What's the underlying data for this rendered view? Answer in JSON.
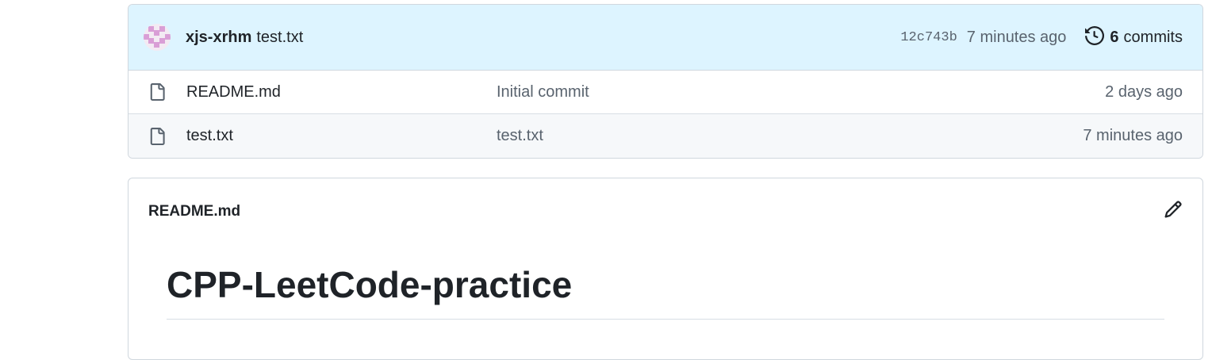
{
  "latest_commit": {
    "author": "xjs-xrhm",
    "message": "test.txt",
    "sha": "12c743b",
    "time": "7 minutes ago",
    "commit_count": "6",
    "commit_count_label": "commits"
  },
  "files": [
    {
      "name": "README.md",
      "commit_message": "Initial commit",
      "age": "2 days ago",
      "icon": "file-icon"
    },
    {
      "name": "test.txt",
      "commit_message": "test.txt",
      "age": "7 minutes ago",
      "icon": "file-icon"
    }
  ],
  "readme": {
    "filename": "README.md",
    "heading": "CPP-LeetCode-practice"
  },
  "colors": {
    "commit_bar_bg": "#ddf4ff",
    "border": "#d0d7de",
    "muted_text": "#59636e",
    "avatar_accent": "#d99ed6"
  }
}
